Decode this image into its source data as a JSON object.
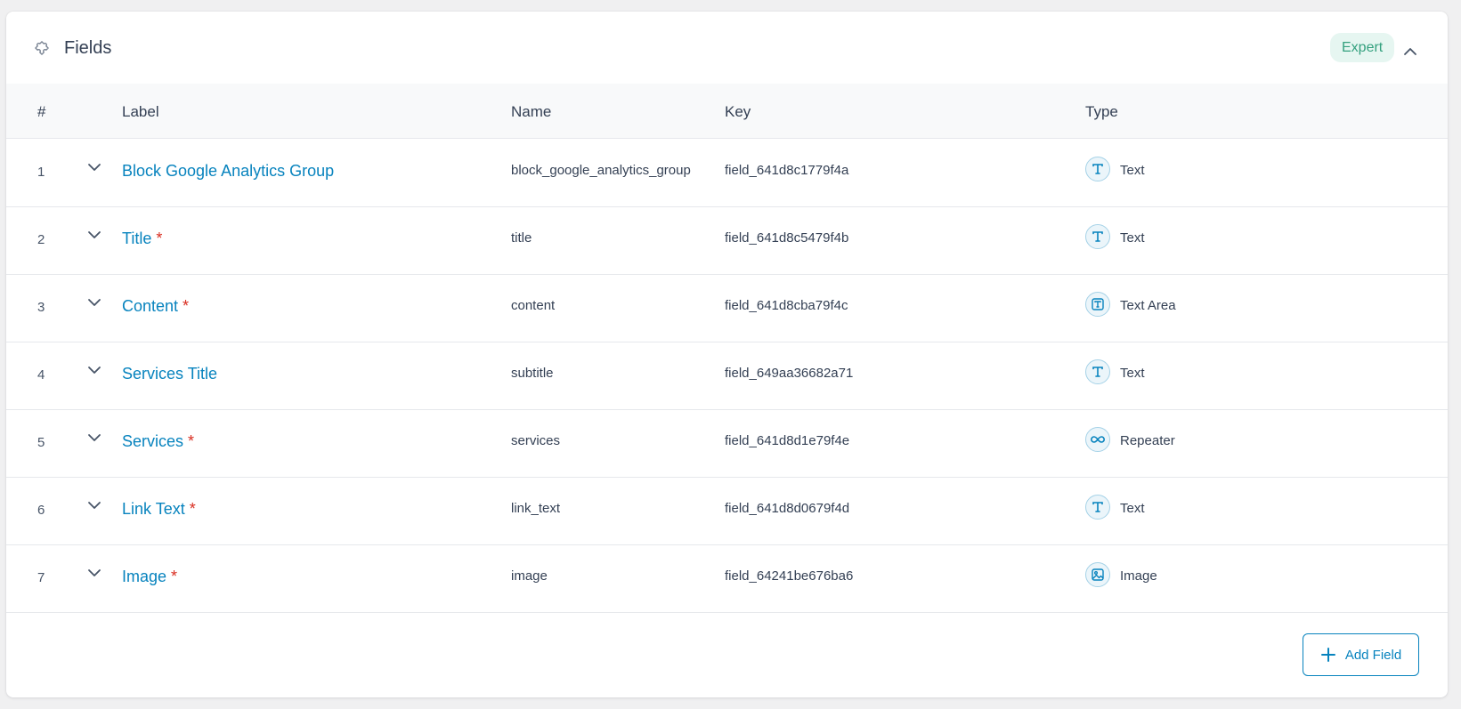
{
  "panel": {
    "title": "Fields",
    "title_icon": "puzzle-icon",
    "badge": "Expert",
    "collapse_icon": "chevron-up-icon"
  },
  "table": {
    "columns": [
      "#",
      "Label",
      "Name",
      "Key",
      "Type"
    ],
    "rows": [
      {
        "num": "1",
        "label": "Block Google Analytics Group",
        "required": false,
        "required_mark": "",
        "name": "block_google_analytics_group",
        "key": "field_641d8c1779f4a",
        "type": "Text",
        "type_icon": "text-icon"
      },
      {
        "num": "2",
        "label": "Title",
        "required": true,
        "required_mark": "*",
        "name": "title",
        "key": "field_641d8c5479f4b",
        "type": "Text",
        "type_icon": "text-icon"
      },
      {
        "num": "3",
        "label": "Content",
        "required": true,
        "required_mark": "*",
        "name": "content",
        "key": "field_641d8cba79f4c",
        "type": "Text Area",
        "type_icon": "textarea-icon"
      },
      {
        "num": "4",
        "label": "Services Title",
        "required": false,
        "required_mark": "",
        "name": "subtitle",
        "key": "field_649aa36682a71",
        "type": "Text",
        "type_icon": "text-icon"
      },
      {
        "num": "5",
        "label": "Services",
        "required": true,
        "required_mark": "*",
        "name": "services",
        "key": "field_641d8d1e79f4e",
        "type": "Repeater",
        "type_icon": "repeater-icon"
      },
      {
        "num": "6",
        "label": "Link Text",
        "required": true,
        "required_mark": "*",
        "name": "link_text",
        "key": "field_641d8d0679f4d",
        "type": "Text",
        "type_icon": "text-icon"
      },
      {
        "num": "7",
        "label": "Image",
        "required": true,
        "required_mark": "*",
        "name": "image",
        "key": "field_64241be676ba6",
        "type": "Image",
        "type_icon": "image-icon"
      }
    ]
  },
  "footer": {
    "add_button": "Add Field",
    "add_icon": "plus-icon"
  },
  "colors": {
    "link": "#0783be",
    "required": "#d92d20",
    "badge_bg": "#e6f6f1",
    "badge_text": "#35a17f"
  }
}
